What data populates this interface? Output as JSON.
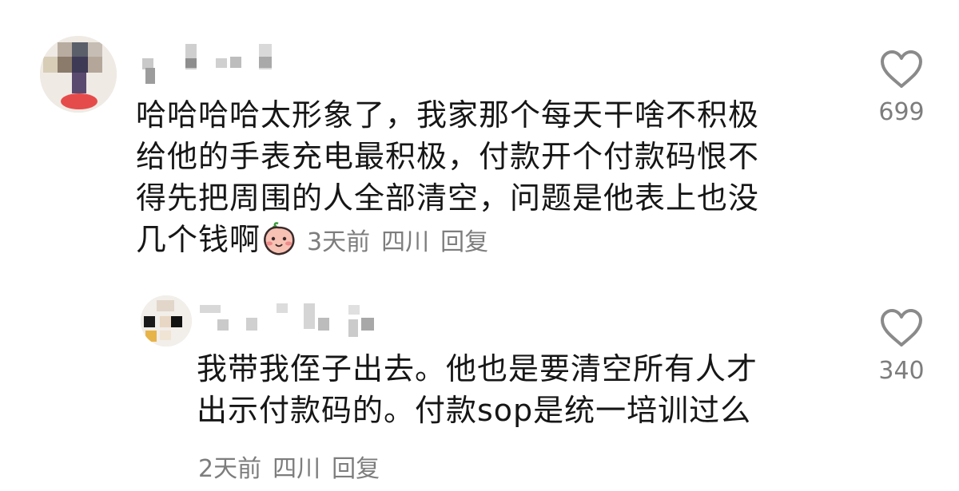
{
  "comments": [
    {
      "username": "",
      "lines": [
        "哈哈哈哈太形象了，我家那个每天干啥不积极",
        "给他的手表充电最积极，付款开个付款码恨不",
        "得先把周围的人全部清空，问题是他表上也没",
        "几个钱啊"
      ],
      "sticker_icon": "peach-sticker-icon",
      "time": "3天前",
      "location": "四川",
      "reply_label": "回复",
      "likes": "699"
    },
    {
      "username": "",
      "lines": [
        "我带我侄子出去。他也是要清空所有人才",
        "出示付款码的。付款sop是统一培训过么"
      ],
      "time": "2天前",
      "location": "四川",
      "reply_label": "回复",
      "likes": "340"
    }
  ],
  "colors": {
    "text": "#161616",
    "meta": "#7d7d7d",
    "heart_outline": "#8a8a8a"
  }
}
